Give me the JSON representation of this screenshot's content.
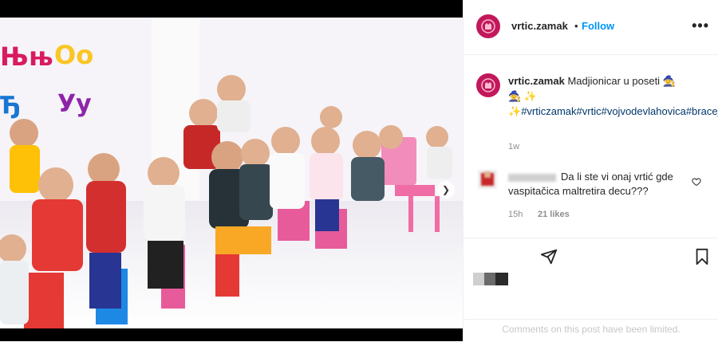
{
  "post": {
    "username": "vrtic.zamak",
    "follow_label": "Follow",
    "separator": "•",
    "more_icon": "more-horizontal-icon"
  },
  "caption": {
    "username": "vrtic.zamak",
    "text": "Madjionicar u poseti",
    "hashtags": "#vrticzamak#vrtic#vojvodevlahovica#bracejerkovic",
    "time": "1w"
  },
  "comment": {
    "text": "Da li ste vi onaj vrtić gde vaspitačica maltretira decu???",
    "time": "15h",
    "likes": "21 likes"
  },
  "limited_notice": "Comments on this post have been limited.",
  "colors": {
    "accent": "#0095f6",
    "brand": "#c2185b",
    "hashtag": "#00376b"
  }
}
